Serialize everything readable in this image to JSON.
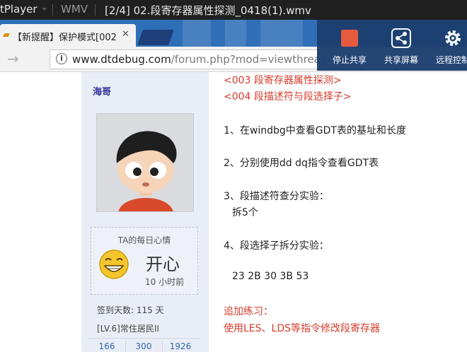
{
  "player": {
    "app_title": "tPlayer",
    "format": "WMV",
    "file_title": "[2/4] 02.段寄存器属性探测_0418(1).wmv"
  },
  "browser": {
    "tab_title": "【新提醒】保护模式[002",
    "url_host": "www.dtdebug.com",
    "url_path": "/forum.php?mod=viewthread"
  },
  "share_panel": {
    "stop_label": "停止共享",
    "screen_label": "共享屏幕",
    "remote_label": "远程控制",
    "stop_color": "#f05a3a"
  },
  "sidebar": {
    "username": "海哥",
    "mood_title": "TA的每日心情",
    "mood": "开心",
    "mood_time": "10 小时前",
    "signin_days": "签到天数: 115 天",
    "level": "[LV.6]常住居民II",
    "stats": [
      "166",
      "300",
      "1926"
    ]
  },
  "post": {
    "link_003": "<003 段寄存器属性探测>",
    "link_004": "<004 段描述符与段选择子>",
    "item1": "1、在windbg中查看GDT表的基址和长度",
    "item2": "2、分别使用dd dq指令查看GDT表",
    "item3": "3、段描述符查分实验：",
    "item3_sub": "拆5个",
    "item4": "4、段选择子拆分实验：",
    "item4_values": "23 2B 30 3B 53",
    "practice_title": "追加练习：",
    "practice_body": "使用LES、LDS等指令修改段寄存器"
  }
}
